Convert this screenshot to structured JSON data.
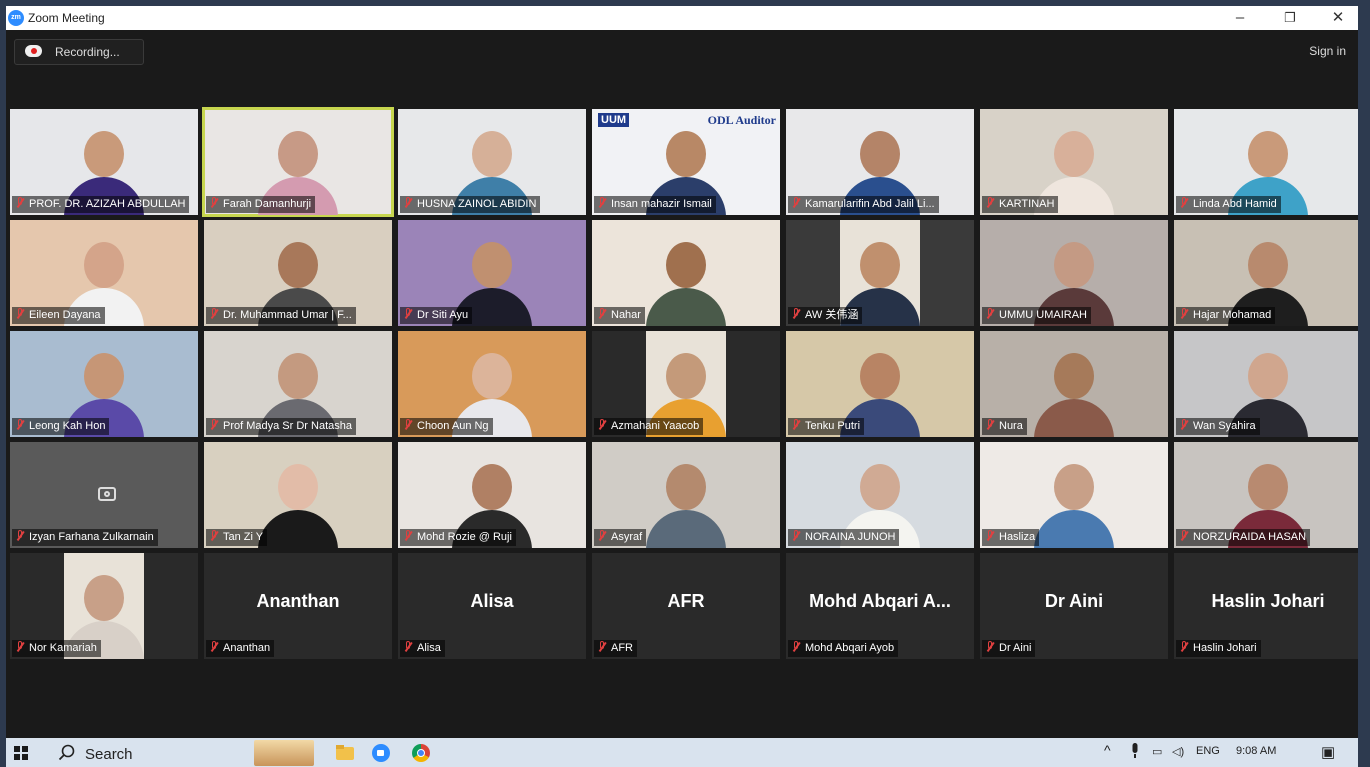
{
  "window": {
    "title": "Zoom Meeting",
    "minimize": "–",
    "maximize": "❐",
    "close": "✕"
  },
  "toolbar": {
    "recording": "Recording...",
    "sign_in": "Sign in"
  },
  "participants": [
    {
      "name": "PROF. DR. AZIZAH ABDULLAH",
      "bg": "#e6e7ea",
      "skin": "#c99a7a",
      "cloth": "#3a2a7a"
    },
    {
      "name": "Farah Damanhurji",
      "bg": "#e9e6e4",
      "skin": "#c79a86",
      "cloth": "#d49bb0",
      "active": true
    },
    {
      "name": "HUSNA ZAINOL ABIDIN",
      "bg": "#e7e8ea",
      "skin": "#d6b098",
      "cloth": "#3f7fa8"
    },
    {
      "name": "Insan mahazir Ismail",
      "bg": "#f1f2f5",
      "skin": "#b88866",
      "cloth": "#2b3e6a",
      "overlay_text": "ODL Auditor",
      "logo_text": "UUM"
    },
    {
      "name": "Kamarularifin Abd Jalil Li...",
      "bg": "#e8e8ea",
      "skin": "#b48468",
      "cloth": "#2a4f8e"
    },
    {
      "name": "KARTINAH",
      "bg": "#d8d2c8",
      "skin": "#d8b09a",
      "cloth": "#efe6de"
    },
    {
      "name": "Linda Abd Hamid",
      "bg": "#e6e8ea",
      "skin": "#c99a7a",
      "cloth": "#3ea2c8"
    },
    {
      "name": "Eileen Dayana",
      "bg": "#e5c7ad",
      "skin": "#d4a48a",
      "cloth": "#f2f2f2"
    },
    {
      "name": "Dr. Muhammad Umar | F...",
      "bg": "#d9cfc0",
      "skin": "#a8785a",
      "cloth": "#4a4a4a"
    },
    {
      "name": "Dr Siti Ayu",
      "bg": "#9b84b8",
      "skin": "#c09070",
      "cloth": "#1c1c2a"
    },
    {
      "name": "Nahar",
      "bg": "#ece4da",
      "skin": "#a0704e",
      "cloth": "#4a5a4a"
    },
    {
      "name": "AW 关伟涵",
      "bg": "#3a3a3a",
      "skin": "#c0906e",
      "cloth": "#263248"
    },
    {
      "name": "UMMU UMAIRAH",
      "bg": "#b6aeaa",
      "skin": "#c49a84",
      "cloth": "#5a3a3a"
    },
    {
      "name": "Hajar Mohamad",
      "bg": "#c8c0b4",
      "skin": "#b88a6e",
      "cloth": "#1e1e1e"
    },
    {
      "name": "Leong Kah Hon",
      "bg": "#a9bcd0",
      "skin": "#c69676",
      "cloth": "#5a4aa8"
    },
    {
      "name": "Prof Madya Sr Dr Natasha",
      "bg": "#d8d4ce",
      "skin": "#c49a80",
      "cloth": "#6a6a70"
    },
    {
      "name": "Choon Aun Ng",
      "bg": "#d89a5a",
      "skin": "#dcb49a",
      "cloth": "#e8e8ec"
    },
    {
      "name": "Azmahani Yaacob",
      "bg": "#2a2a2a",
      "skin": "#c49a7a",
      "cloth": "#e8a030"
    },
    {
      "name": "Tenku Putri",
      "bg": "#d6c8a8",
      "skin": "#b88464",
      "cloth": "#3a4a7a"
    },
    {
      "name": "Nura",
      "bg": "#b8b0a8",
      "skin": "#a67a5a",
      "cloth": "#8a5a4a"
    },
    {
      "name": "Wan Syahira",
      "bg": "#c6c6c8",
      "skin": "#d0a68e",
      "cloth": "#2a2a32"
    },
    {
      "name": "Izyan Farhana Zulkarnain",
      "bg": "#5a5a5a",
      "skin": "",
      "cloth": "",
      "camera_off": true
    },
    {
      "name": "Tan Zi Y",
      "bg": "#d8d0c0",
      "skin": "#e2bca8",
      "cloth": "#1a1a1a"
    },
    {
      "name": "Mohd Rozie @ Ruji",
      "bg": "#e8e4e0",
      "skin": "#b08064",
      "cloth": "#2a2a2a"
    },
    {
      "name": "Asyraf",
      "bg": "#d0ccc6",
      "skin": "#b48a6e",
      "cloth": "#5a6a7a"
    },
    {
      "name": "NORAINA JUNOH",
      "bg": "#d6dbe0",
      "skin": "#d0aa94",
      "cloth": "#f4f4f0"
    },
    {
      "name": "Hasliza",
      "bg": "#eeeae6",
      "skin": "#c8a088",
      "cloth": "#4a7ab0"
    },
    {
      "name": "NORZURAIDA HASAN",
      "bg": "#c8c4c0",
      "skin": "#b88a70",
      "cloth": "#7a2a3a"
    },
    {
      "name": "Nor Kamariah",
      "bg": "#2a2a2a",
      "skin": "#c8a088",
      "cloth": "#d8d0c8"
    },
    {
      "name": "Ananthan",
      "display": "Ananthan"
    },
    {
      "name": "Alisa",
      "display": "Alisa"
    },
    {
      "name": "AFR",
      "display": "AFR"
    },
    {
      "name": "Mohd Abqari Ayob",
      "display": "Mohd Abqari A..."
    },
    {
      "name": "Dr Aini",
      "display": "Dr Aini"
    },
    {
      "name": "Haslin Johari",
      "display": "Haslin Johari"
    }
  ],
  "taskbar": {
    "search": "Search",
    "language": "ENG",
    "time": "9:08 AM",
    "up_arrow": "^",
    "battery": "▭",
    "volume": "◁)",
    "notification": "▣"
  }
}
